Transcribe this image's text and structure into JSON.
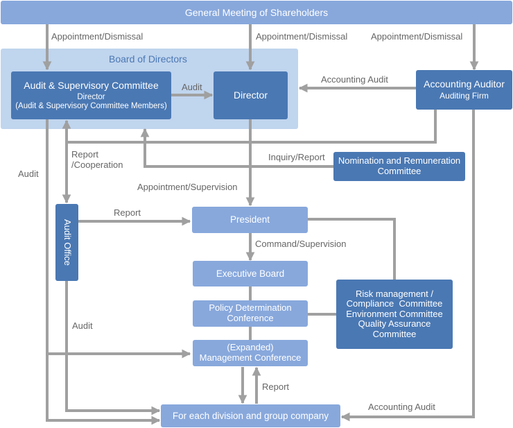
{
  "diagram": {
    "type": "corporate-governance-org-chart",
    "colors": {
      "light_box": "#88a8dc",
      "dark_box": "#4a78b3",
      "board_region": "#c0d5ee",
      "board_title": "#4a78b3",
      "connector": "#a0a0a0",
      "label_text": "#666666"
    },
    "nodes": {
      "shareholders": "General Meeting of Shareholders",
      "board": "Board of Directors",
      "audit_committee": {
        "title": "Audit & Supervisory Committee",
        "line1": "Director",
        "line2": "(Audit & Supervisory Committee Members)"
      },
      "director": "Director",
      "accounting_auditor": {
        "title": "Accounting Auditor",
        "subtitle": "Auditing Firm"
      },
      "nomination": {
        "line1": "Nomination and Remuneration",
        "line2": "Committee"
      },
      "audit_office": "Audit Office",
      "president": "President",
      "executive_board": "Executive Board",
      "policy": {
        "line1": "Policy Determination",
        "line2": "Conference"
      },
      "management": {
        "line1": "(Expanded)",
        "line2": "Management Conference"
      },
      "risk": {
        "line1": "Risk management /",
        "line2": "Compliance  Committee",
        "line3": "Environment Committee",
        "line4": "Quality Assurance",
        "line5": "Committee"
      },
      "divisions": "For each division and group company"
    },
    "edge_labels": {
      "appt1": "Appointment/Dismissal",
      "appt2": "Appointment/Dismissal",
      "appt3": "Appointment/Dismissal",
      "audit_to_director": "Audit",
      "accounting_audit_top": "Accounting Audit",
      "report_coop_1": "Report",
      "report_coop_2": "/Cooperation",
      "inquiry": "Inquiry/Report",
      "audit_left": "Audit",
      "appt_supervision": "Appointment/Supervision",
      "report_office": "Report",
      "command": "Command/Supervision",
      "audit_office_audit": "Audit",
      "report_bottom": "Report",
      "accounting_audit_bottom": "Accounting Audit"
    }
  }
}
